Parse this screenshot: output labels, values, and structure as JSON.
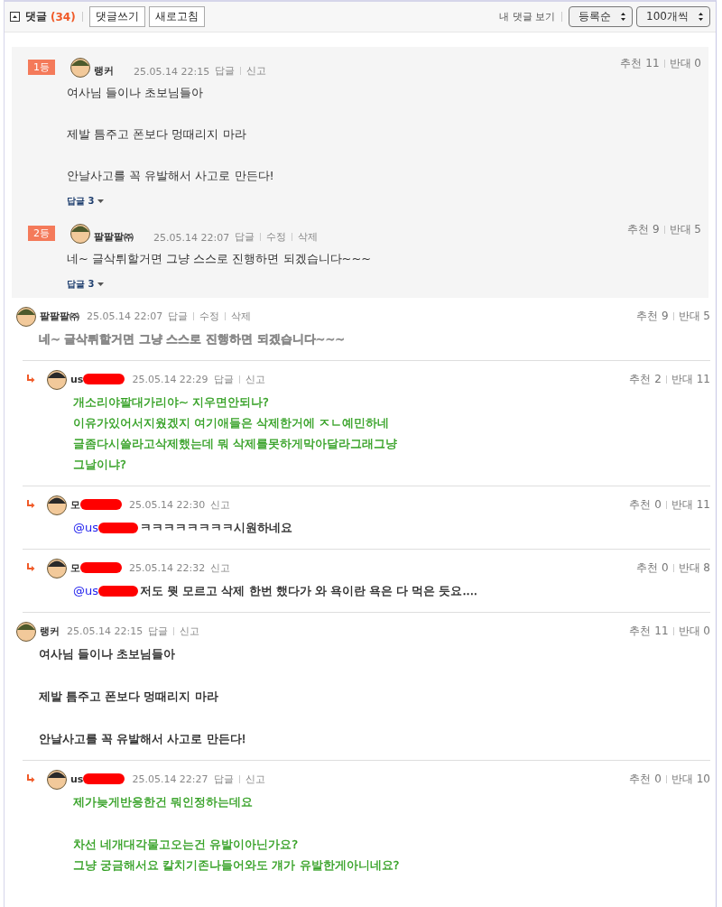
{
  "header": {
    "title": "댓글",
    "count": "(34)",
    "buttons": [
      "댓글쓰기",
      "새로고침"
    ],
    "my_comments": "내 댓글 보기",
    "selects": [
      "등록순",
      "100개씩"
    ]
  },
  "best": [
    {
      "rank": "1등",
      "author": "랭커",
      "time": "25.05.14 22:15",
      "actions": [
        "답글",
        "신고"
      ],
      "paragraphs": [
        [
          "여사님 들이나 초보님들아"
        ],
        [
          "제발 틈주고 폰보다 멍때리지 마라"
        ],
        [
          "안날사고를 꼭 유발해서 사고로 만든다!"
        ]
      ],
      "replies": "답글 3",
      "up": "추천 11",
      "down": "반대 0"
    },
    {
      "rank": "2등",
      "author": "팔팔팔㈜",
      "time": "25.05.14 22:07",
      "actions": [
        "답글",
        "수정",
        "삭제"
      ],
      "paragraphs": [
        [
          "네~ 글삭튀할거면 그냥 스스로 진행하면 되겠습니다~~~"
        ]
      ],
      "replies": "답글 3",
      "up": "추천 9",
      "down": "반대 5"
    }
  ],
  "comments": [
    {
      "kind": "comment",
      "author": "팔팔팔㈜",
      "redacted": false,
      "time": "25.05.14 22:07",
      "actions": [
        "답글",
        "수정",
        "삭제"
      ],
      "color": "#8a8a8a",
      "paragraphs": [
        [
          "네~ 글삭튀할거면 그냥 스스로 진행하면 되겠습니다~~~"
        ]
      ],
      "up": "추천 9",
      "down": "반대 5"
    },
    {
      "kind": "reply",
      "author": "us",
      "redacted": true,
      "time": "25.05.14 22:29",
      "actions": [
        "답글",
        "신고"
      ],
      "color": "#2f9e1f",
      "paragraphs": [
        [
          "개소리야팔대가리야~ 지우면안되나?",
          "이유가있어서지웠겠지 여기애들은 삭제한거에 ㅈㄴ예민하네",
          "글좀다시쓸라고삭제했는데 뭐 삭제를못하게막아달라그래그냥",
          "그날이냐?"
        ]
      ],
      "up": "추천 2",
      "down": "반대 11"
    },
    {
      "kind": "reply",
      "author": "모",
      "redacted": true,
      "time": "25.05.14 22:30",
      "actions": [
        "신고"
      ],
      "color": "#222222",
      "mention": "@us",
      "paragraphs": [
        [
          "ㅋㅋㅋㅋㅋㅋㅋㅋ시원하네요"
        ]
      ],
      "up": "추천 0",
      "down": "반대 11"
    },
    {
      "kind": "reply",
      "author": "모",
      "redacted": true,
      "time": "25.05.14 22:32",
      "actions": [
        "신고"
      ],
      "color": "#222222",
      "mention": "@us",
      "paragraphs": [
        [
          "저도 뭣 모르고 삭제 한번 했다가 와 욕이란 욕은 다 먹은 듯요...."
        ]
      ],
      "up": "추천 0",
      "down": "반대 8"
    },
    {
      "kind": "comment",
      "author": "랭커",
      "redacted": false,
      "time": "25.05.14 22:15",
      "actions": [
        "답글",
        "신고"
      ],
      "color": "#222222",
      "paragraphs": [
        [
          "여사님 들이나 초보님들아"
        ],
        [
          "제발 틈주고 폰보다 멍때리지 마라"
        ],
        [
          "안날사고를 꼭 유발해서 사고로 만든다!"
        ]
      ],
      "up": "추천 11",
      "down": "반대 0"
    },
    {
      "kind": "reply",
      "author": "us",
      "redacted": true,
      "time": "25.05.14 22:27",
      "actions": [
        "답글",
        "신고"
      ],
      "color": "#2f9e1f",
      "paragraphs": [
        [
          "제가늦게반응한건 뭐인정하는데요"
        ],
        [
          "차선 네개대각물고오는건 유발이아닌가요?",
          "그냥 궁금해서요 칼치기존나들어와도 걔가 유발한게아니네요?"
        ]
      ],
      "up": "추천 0",
      "down": "반대 10"
    }
  ]
}
